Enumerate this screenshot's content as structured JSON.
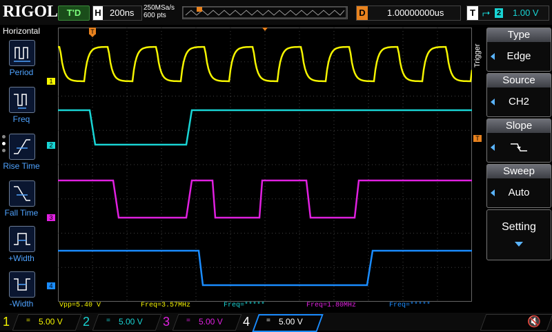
{
  "brand": "RIGOL",
  "top": {
    "run_state": "T'D",
    "timebase_key": "H",
    "timebase": "200ns",
    "sample_rate": "250MSa/s",
    "mem_depth": "600 pts",
    "delay_key": "D",
    "delay": "1.00000000us",
    "trigger_key": "T",
    "trigger_channel": "2",
    "trigger_level": "1.00 V"
  },
  "left_panel": {
    "title": "Horizontal",
    "items": [
      {
        "label": "Period",
        "icon": "period-icon"
      },
      {
        "label": "Freq",
        "icon": "freq-icon"
      },
      {
        "label": "Rise Time",
        "icon": "rise-time-icon"
      },
      {
        "label": "Fall Time",
        "icon": "fall-time-icon"
      },
      {
        "label": "+Width",
        "icon": "pos-width-icon"
      },
      {
        "label": "-Width",
        "icon": "neg-width-icon"
      }
    ]
  },
  "right_menu": {
    "section": "Trigger",
    "items": [
      {
        "head": "Type",
        "value": "Edge"
      },
      {
        "head": "Source",
        "value": "CH2"
      },
      {
        "head": "Slope",
        "value": ""
      },
      {
        "head": "Sweep",
        "value": "Auto"
      }
    ],
    "setting": "Setting"
  },
  "measurements": {
    "vpp": "Vpp=5.40 V",
    "freq1": "Freq=3.57MHz",
    "freq2": "Freq=*****",
    "freq3": "Freq=1.80MHz",
    "freq4": "Freq=*****"
  },
  "channels": [
    {
      "num": "1",
      "volts": "5.00 V",
      "color": "#f5f500"
    },
    {
      "num": "2",
      "volts": "5.00 V",
      "color": "#19d4d4"
    },
    {
      "num": "3",
      "volts": "5.00 V",
      "color": "#e020e0"
    },
    {
      "num": "4",
      "volts": "5.00 V",
      "color": "#1a8cff"
    }
  ],
  "markers": {
    "ch1": "1",
    "ch2": "2",
    "ch3": "3",
    "ch4": "4",
    "trig": "T"
  },
  "colors": {
    "ch1": "#f5f500",
    "ch2": "#19d4d4",
    "ch3": "#e020e0",
    "ch4": "#1a8cff",
    "accent": "#e8821e",
    "menu_arrow": "#5ab4ff"
  }
}
